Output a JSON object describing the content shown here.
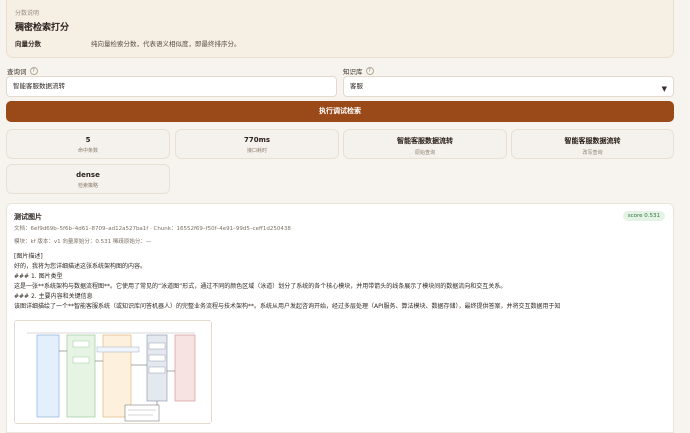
{
  "explain": {
    "small": "分数说明",
    "title": "稠密检索打分",
    "key": "向量分数",
    "value": "纯向量检索分数，代表语义相似度，即最终排序分。"
  },
  "query": {
    "label": "查询词",
    "value": "智能客服数据流转"
  },
  "kb": {
    "label": "知识库",
    "value": "客服"
  },
  "run_button": "执行调试检索",
  "stats": [
    {
      "value": "5",
      "caption": "命中条数"
    },
    {
      "value": "770ms",
      "caption": "接口耗时"
    },
    {
      "value": "智能客服数据流转",
      "caption": "原始查询"
    },
    {
      "value": "智能客服数据流转",
      "caption": "改写查询"
    },
    {
      "value": "dense",
      "caption": "检索策略"
    }
  ],
  "result": {
    "title": "测试图片",
    "score": "score 0.531",
    "doc_line": "文档：6ef9d69b–5f6b–4d61–8709–ad12a527ba1f · Chunk：16552f69–f50f–4e91–99d5–ceff1d250438",
    "meta_line": "模块：kf  版本：v1  向量原始分：0.531  稀疏原始分：—",
    "lines": [
      "[图片描述]",
      "好的，我将为您详细描述这张系统架构图的内容。",
      "### 1. 图片类型",
      "这是一张**系统架构与数据流程图**。它使用了常见的“泳道图”形式，通过不同的颜色区域（泳道）划分了系统的各个核心模块，并用带箭头的线条展示了模块间的数据流向和交互关系。",
      "### 2. 主要内容和关键信息",
      "该图详细描绘了一个**智能客服系统（或知识库问答机器人）的完整业务流程与技术架构**。系统从用户发起咨询开始，经过多层处理（API服务、算法模块、数据存储），最终提供答案，并将交互数据用于知"
    ]
  },
  "colors": {
    "accent": "#9a4a18",
    "score_bg": "#e4f3e6",
    "score_fg": "#2f7a3d"
  },
  "icons": [
    "help-icon",
    "chevron-down-icon"
  ]
}
